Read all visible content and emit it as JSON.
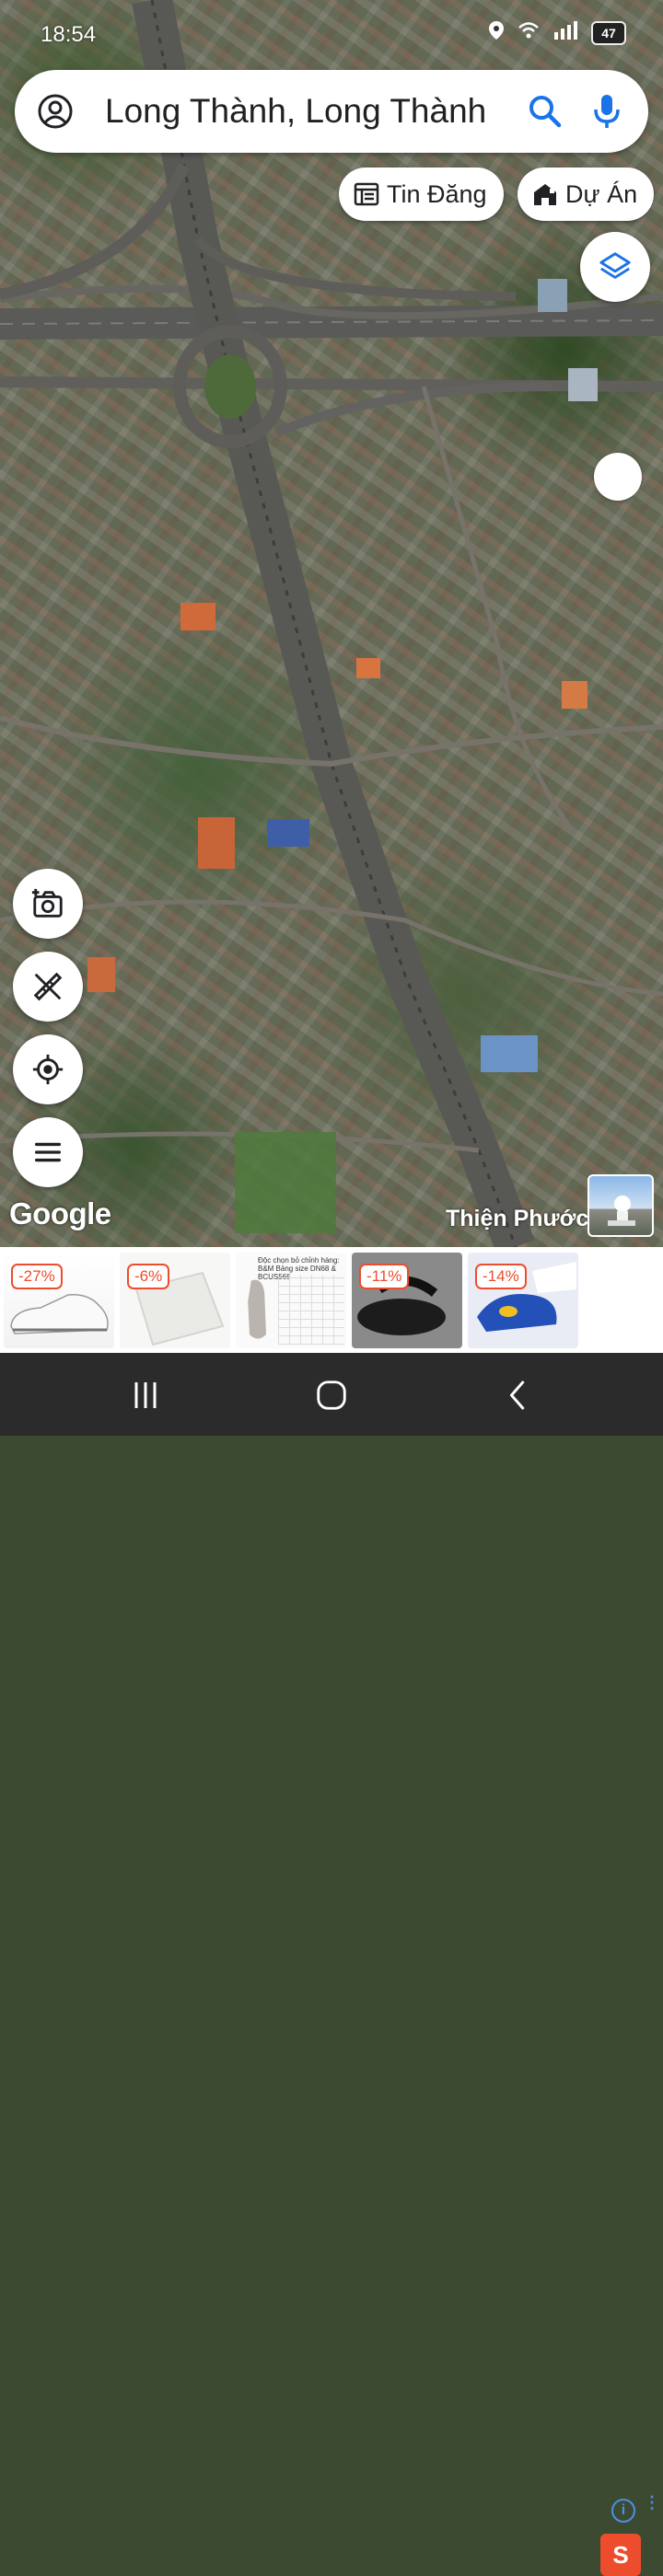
{
  "status_bar": {
    "time": "18:54",
    "battery": "47",
    "icons": [
      "location-icon",
      "wifi-icon",
      "signal-icon",
      "battery-icon"
    ]
  },
  "search": {
    "account_icon": "account-circle-icon",
    "query": "Long Thành, Long Thành",
    "search_icon": "search-icon",
    "mic_icon": "microphone-icon"
  },
  "chips": [
    {
      "label": "Tin Đăng",
      "icon": "listing-icon"
    },
    {
      "label": "Dự Án",
      "icon": "building-icon"
    }
  ],
  "map_controls": {
    "layers_icon": "layers-icon",
    "left_buttons": [
      "add-photo-icon",
      "measure-tool-icon",
      "my-location-icon",
      "menu-icon"
    ]
  },
  "map": {
    "attribution": "Google",
    "place_label": "Thiện Phước"
  },
  "ads": {
    "items": [
      {
        "discount": "-27%"
      },
      {
        "discount": "-6%"
      },
      {
        "discount": "",
        "title": "Độc chọn bỏ chỉnh hàng: B&M Bảng size DN68 & BCUS568"
      },
      {
        "discount": "-11%"
      },
      {
        "discount": "-14%"
      }
    ],
    "sponsor_icon": "shopee-icon",
    "info_icon": "info-icon",
    "colors": {
      "discount": "#ee4d2d",
      "shopee": "#ee4d2d"
    }
  },
  "nav": {
    "buttons": [
      "recent-apps-icon",
      "home-icon",
      "back-icon"
    ]
  },
  "colors": {
    "accent_blue": "#1a73e8",
    "nav_bg": "#2b2b2b"
  }
}
